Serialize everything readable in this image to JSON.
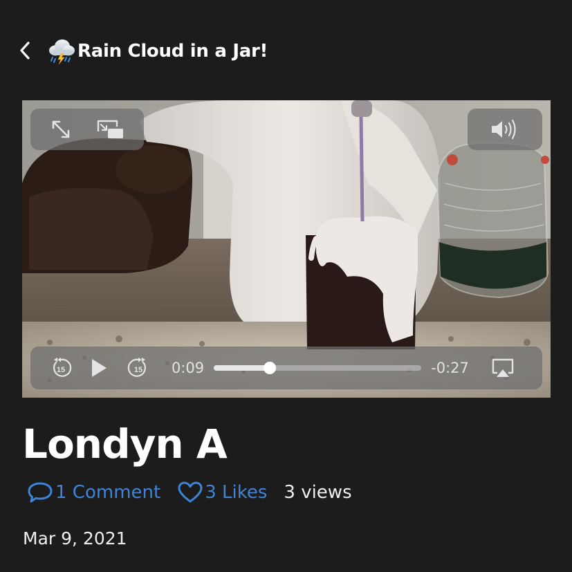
{
  "header": {
    "back_icon": "chevron-left-icon",
    "title_icon": "cloud-with-lightning-and-rain-icon",
    "title": "Rain Cloud in a Jar!"
  },
  "video": {
    "top_left_controls": [
      "expand-icon",
      "picture-in-picture-icon"
    ],
    "top_right_controls": [
      "volume-icon"
    ],
    "skip_back_label": "15",
    "skip_forward_label": "15",
    "elapsed": "0:09",
    "remaining": "-0:27",
    "progress_fraction": 0.27,
    "airplay_icon": "airplay-icon"
  },
  "post": {
    "author": "Londyn A",
    "comments": "1 Comment",
    "likes": "3 Likes",
    "views": "3 views",
    "date": "Mar 9, 2021"
  },
  "colors": {
    "background": "#1c1c1c",
    "link": "#3f84d8",
    "text": "#ffffff"
  }
}
